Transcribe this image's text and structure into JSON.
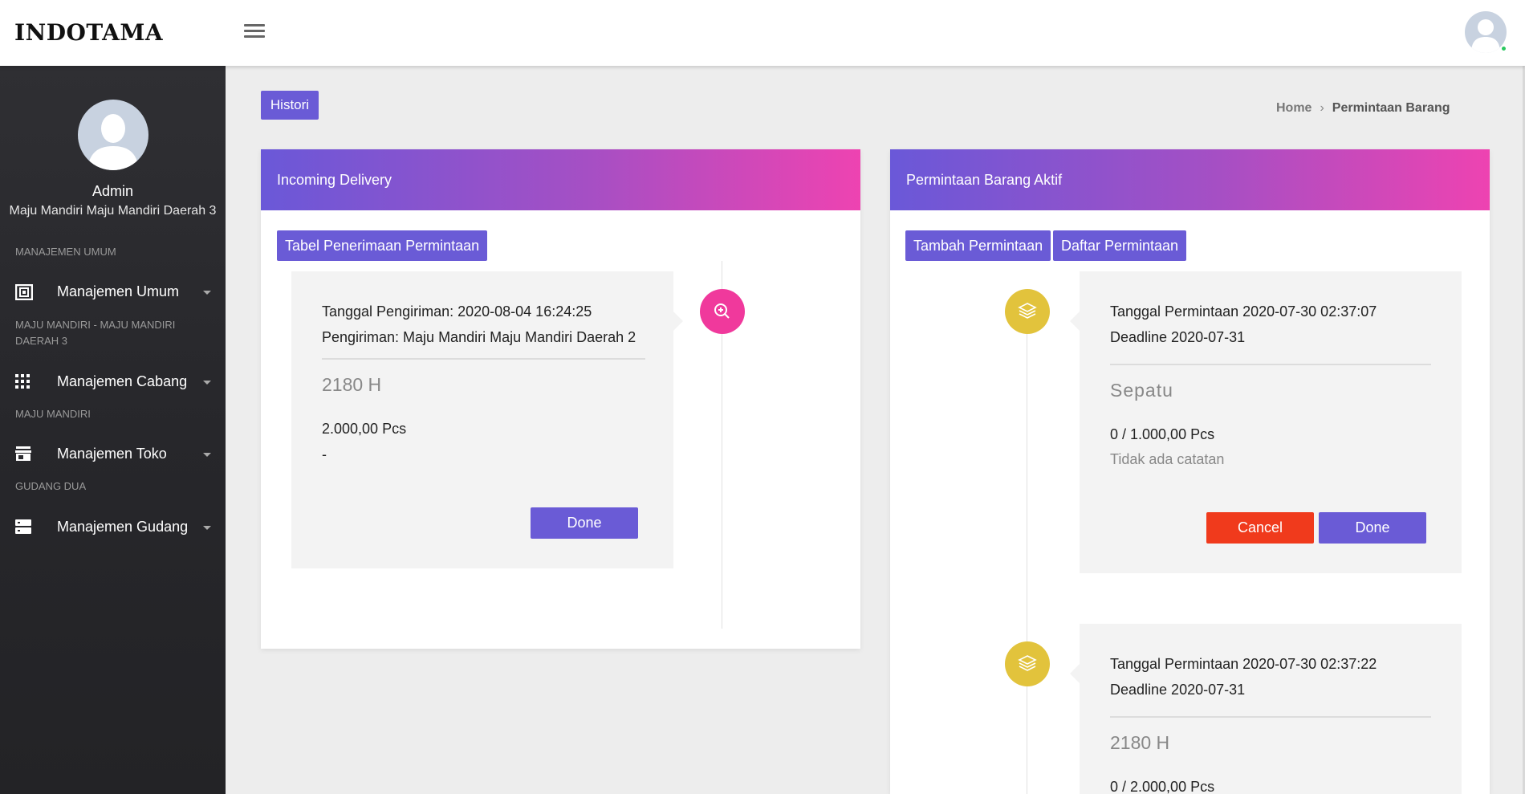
{
  "header": {
    "brand": "INDOTAMA",
    "menu_icon": "hamburger-icon",
    "avatar_icon": "user-avatar-icon",
    "online_color": "#29c75f"
  },
  "sidebar": {
    "user_name": "Admin",
    "user_sub": "Maju Mandiri Maju Mandiri Daerah 3",
    "sections": [
      {
        "label": "MANAJEMEN UMUM",
        "item": {
          "label": "Manajemen Umum",
          "icon": "building-icon"
        }
      },
      {
        "label": "MAJU MANDIRI - MAJU MANDIRI DAERAH 3",
        "item": {
          "label": "Manajemen Cabang",
          "icon": "grid-icon"
        }
      },
      {
        "label": "MAJU MANDIRI",
        "item": {
          "label": "Manajemen Toko",
          "icon": "store-icon"
        }
      },
      {
        "label": "GUDANG DUA",
        "item": {
          "label": "Manajemen Gudang",
          "icon": "server-icon"
        }
      }
    ]
  },
  "main": {
    "histori_label": "Histori",
    "breadcrumb": {
      "home": "Home",
      "current": "Permintaan Barang"
    }
  },
  "incoming": {
    "title": "Incoming Delivery",
    "table_button": "Tabel Penerimaan Permintaan",
    "item": {
      "date_line": "Tanggal Pengiriman: 2020-08-04 16:24:25",
      "sender_line": "Pengiriman: Maju Mandiri Maju Mandiri Daerah 2",
      "product": "2180 H",
      "qty": "2.000,00 Pcs",
      "note": "-",
      "done_label": "Done",
      "icon": "zoom-in-icon",
      "icon_color": "#f0399c"
    }
  },
  "active": {
    "title": "Permintaan Barang Aktif",
    "add_button": "Tambah Permintaan",
    "list_button": "Daftar Permintaan",
    "items": [
      {
        "date_line": "Tanggal Permintaan 2020-07-30 02:37:07",
        "deadline_line": "Deadline 2020-07-31",
        "product": "Sepatu",
        "qty": "0 / 1.000,00 Pcs",
        "note": "Tidak ada catatan",
        "cancel_label": "Cancel",
        "done_label": "Done",
        "icon": "layers-icon",
        "icon_color": "#e2c33c"
      },
      {
        "date_line": "Tanggal Permintaan 2020-07-30 02:37:22",
        "deadline_line": "Deadline 2020-07-31",
        "product": "2180 H",
        "qty": "0 / 2.000,00 Pcs",
        "icon": "layers-icon",
        "icon_color": "#e2c33c"
      }
    ]
  },
  "colors": {
    "primary": "#6a5bd6",
    "danger": "#f03a1c",
    "gradient_start": "#6a58d8",
    "gradient_end": "#ee43b1"
  }
}
